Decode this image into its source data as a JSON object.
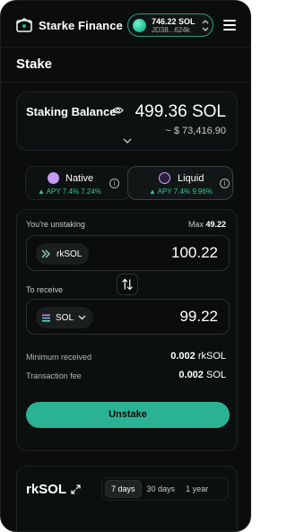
{
  "header": {
    "brand": "Starke Finance",
    "wallet": {
      "balance": "746.22 SOL",
      "address": "JD38...624k"
    }
  },
  "page": {
    "title": "Stake"
  },
  "staking_balance": {
    "label": "Staking Balance",
    "value": "499.36 SOL",
    "usd": "~ $ 73,416.90"
  },
  "tabs": [
    {
      "label": "Native",
      "apy": "APY 7.4% 7.24%",
      "active": false
    },
    {
      "label": "Liquid",
      "apy": "APY 7.4% 9.96%",
      "active": true
    }
  ],
  "unstake": {
    "unstaking_label": "You're unstaking",
    "max_label": "Max",
    "max_value": "49.22",
    "from_token": "rkSOL",
    "from_amount": "100.22",
    "receive_label": "To receive",
    "to_token": "SOL",
    "to_amount": "99.22",
    "min_received_label": "Minimum received",
    "min_received_value": "0.002",
    "min_received_unit": "rkSOL",
    "fee_label": "Transaction fee",
    "fee_value": "0.002",
    "fee_unit": "SOL",
    "button": "Unstake"
  },
  "rk_chart": {
    "title": "rkSOL",
    "ranges": [
      "7 days",
      "30 days",
      "1 year"
    ],
    "active_range": "7 days"
  },
  "colors": {
    "accent": "#2ab393",
    "apy_green": "#2fc99b",
    "background": "#0b0d0d"
  },
  "icons": [
    "logo-icon",
    "wallet-avatar-icon",
    "wallet-toggle-icon",
    "menu-icon",
    "eye-icon",
    "chevron-down-icon",
    "info-icon",
    "swap-icon",
    "expand-icon"
  ]
}
